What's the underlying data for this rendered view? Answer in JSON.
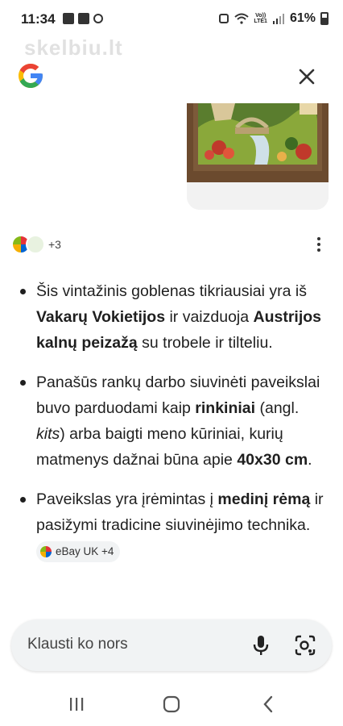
{
  "status_bar": {
    "time": "11:34",
    "network_top": "Vo))",
    "network_bottom": "LTE1",
    "battery": "61%"
  },
  "watermark": "skelbiu.lt",
  "header": {
    "logo_icon": "google-logo-icon",
    "close_icon": "close-icon"
  },
  "sources": {
    "count_label": "+3"
  },
  "bullets": {
    "b1": {
      "t1": "Šis vintažinis goblenas tikriausiai yra iš ",
      "b1": "Vakarų Vokietijos",
      "t2": " ir vaizduoja ",
      "b2": "Austrijos kalnų peizažą",
      "t3": " su trobele ir tilteliu."
    },
    "b2": {
      "t1": "Panašūs rankų darbo siuvinėti paveikslai buvo parduodami kaip ",
      "b1": "rinkiniai",
      "t2": " (angl. ",
      "i1": "kits",
      "t3": ") arba baigti meno kūriniai, kurių matmenys dažnai būna apie ",
      "b2": "40x30 cm",
      "t4": "."
    },
    "b3": {
      "t1": "Paveikslas yra įrėmintas į ",
      "b1": "medinį rėmą",
      "t2": " ir pasižymi tradicine siuvinėjimo technika. ",
      "chip": "eBay UK +4"
    }
  },
  "search": {
    "placeholder": "Klausti ko nors"
  },
  "colors": {
    "accent_blue": "#4285F4",
    "red": "#EA4335",
    "yellow": "#FBBC05",
    "green": "#34A853"
  }
}
